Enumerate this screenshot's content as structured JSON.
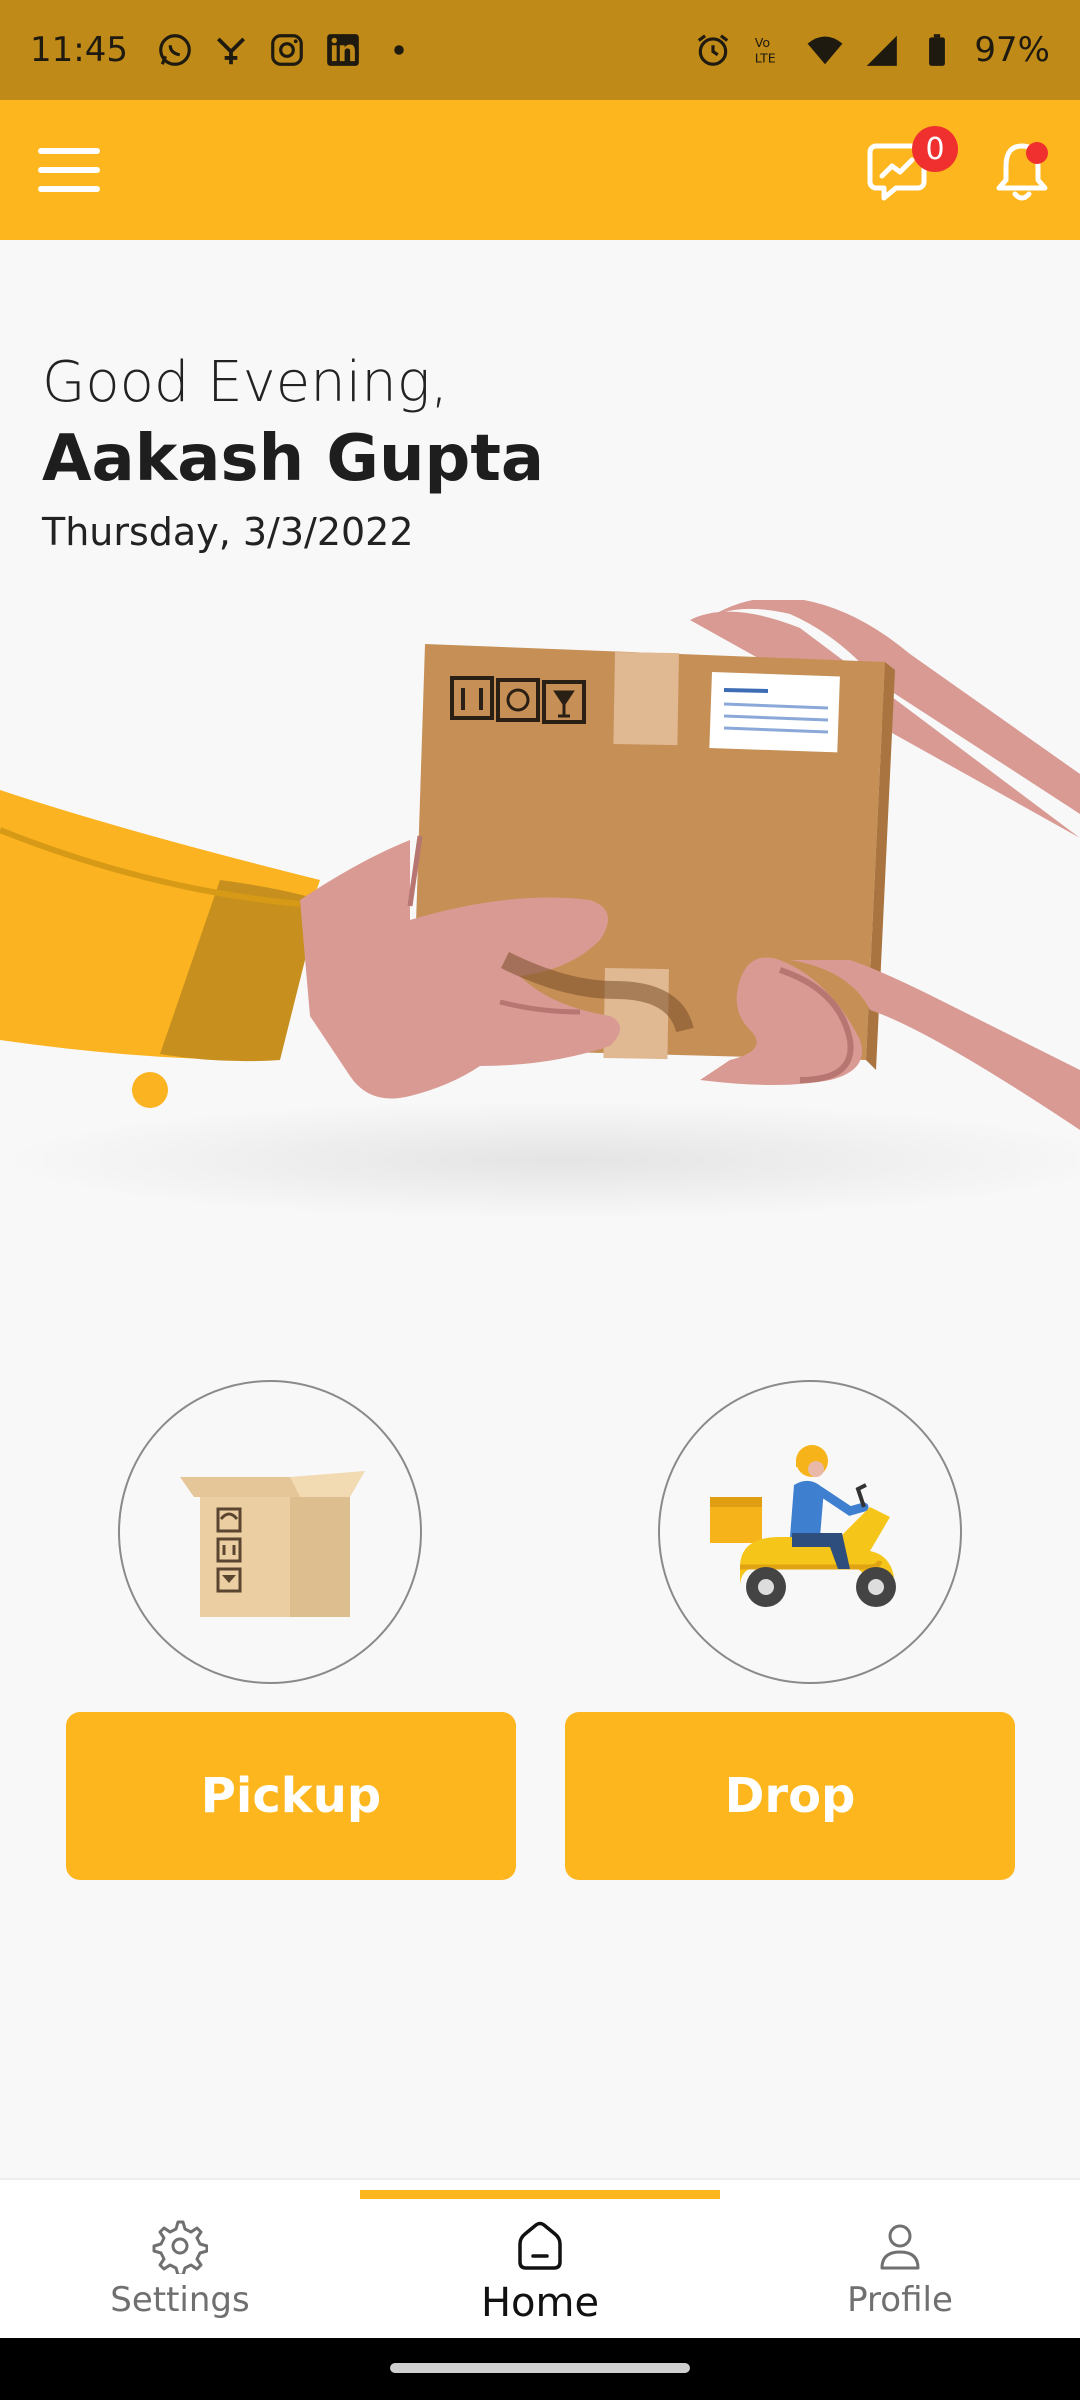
{
  "status_bar": {
    "time": "11:45",
    "battery": "97%",
    "left_icons": [
      "whatsapp-icon",
      "network-icon",
      "instagram-icon",
      "linkedin-icon",
      "dot-icon"
    ],
    "right_icons": [
      "alarm-icon",
      "volte-icon",
      "wifi-icon",
      "lte-signal-icon",
      "battery-icon"
    ]
  },
  "app_bar": {
    "menu_icon": "hamburger-menu-icon",
    "analytics_icon": "analytics-chat-icon",
    "analytics_badge": "0",
    "notification_icon": "bell-icon"
  },
  "greeting": {
    "salutation": "Good Evening,",
    "name": "Aakash Gupta",
    "date": "Thursday, 3/3/2022"
  },
  "actions": {
    "pickup_label": "Pickup",
    "drop_label": "Drop"
  },
  "bottom_nav": {
    "items": [
      {
        "label": "Settings",
        "icon": "gear-icon"
      },
      {
        "label": "Home",
        "icon": "home-icon",
        "active": true
      },
      {
        "label": "Profile",
        "icon": "person-icon"
      }
    ]
  },
  "colors": {
    "accent": "#FDB61E",
    "status_bar": "#BF8A18",
    "badge": "#F0302F"
  }
}
